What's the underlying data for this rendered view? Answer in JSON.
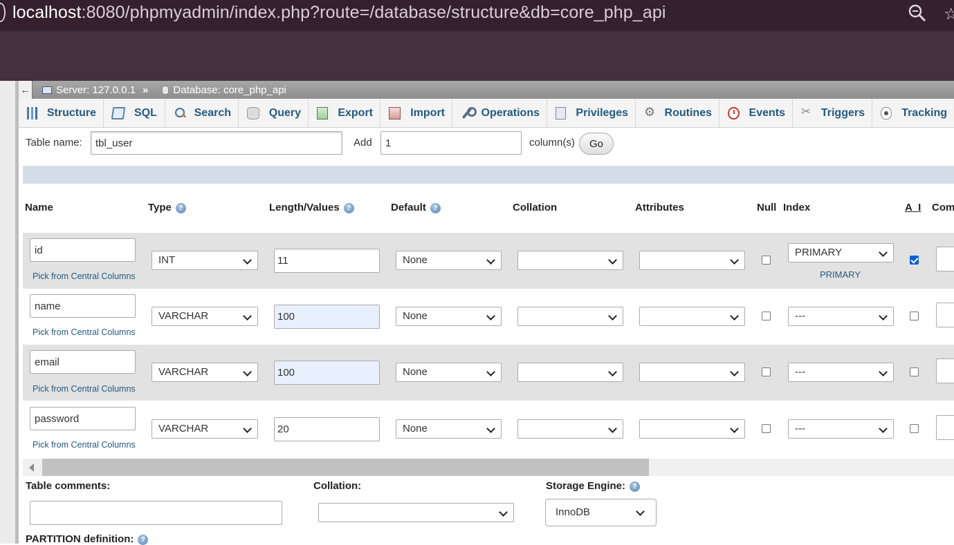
{
  "browser": {
    "url_host": "localhost",
    "url_rest": ":8080/phpmyadmin/index.php?route=/database/structure&db=core_php_api"
  },
  "breadcrumb": {
    "collapse": "←",
    "server": "Server: 127.0.0.1",
    "separator": "»",
    "database": "Database: core_php_api"
  },
  "tabs": [
    {
      "label": "Structure",
      "icon": "structure-icon"
    },
    {
      "label": "SQL",
      "icon": "sql-icon"
    },
    {
      "label": "Search",
      "icon": "search-icon"
    },
    {
      "label": "Query",
      "icon": "query-icon"
    },
    {
      "label": "Export",
      "icon": "export-icon"
    },
    {
      "label": "Import",
      "icon": "import-icon"
    },
    {
      "label": "Operations",
      "icon": "wrench-icon"
    },
    {
      "label": "Privileges",
      "icon": "privileges-icon"
    },
    {
      "label": "Routines",
      "icon": "routines-icon"
    },
    {
      "label": "Events",
      "icon": "events-icon"
    },
    {
      "label": "Triggers",
      "icon": "triggers-icon"
    },
    {
      "label": "Tracking",
      "icon": "tracking-icon"
    }
  ],
  "form": {
    "table_name_label": "Table name:",
    "table_name_value": "tbl_user",
    "add_label": "Add",
    "add_value": "1",
    "columns_label": "column(s)",
    "go_label": "Go"
  },
  "headers": {
    "name": "Name",
    "type": "Type",
    "length": "Length/Values",
    "default": "Default",
    "collation": "Collation",
    "attributes": "Attributes",
    "null": "Null",
    "index": "Index",
    "ai": "A_I",
    "comments": "Com"
  },
  "rows": [
    {
      "name": "id",
      "type": "INT",
      "length": "11",
      "default": "None",
      "index": "PRIMARY",
      "index_note": "PRIMARY",
      "ai": true,
      "pick": "Pick from Central Columns"
    },
    {
      "name": "name",
      "type": "VARCHAR",
      "length": "100",
      "default": "None",
      "index": "---",
      "ai": false,
      "pick": "Pick from Central Columns"
    },
    {
      "name": "email",
      "type": "VARCHAR",
      "length": "100",
      "default": "None",
      "index": "---",
      "ai": false,
      "pick": "Pick from Central Columns"
    },
    {
      "name": "password",
      "type": "VARCHAR",
      "length": "20",
      "default": "None",
      "index": "---",
      "ai": false,
      "pick": "Pick from Central Columns"
    }
  ],
  "bottom": {
    "table_comments_label": "Table comments:",
    "collation_label": "Collation:",
    "storage_engine_label": "Storage Engine:",
    "storage_engine_value": "InnoDB",
    "partition_label": "PARTITION definition:"
  }
}
